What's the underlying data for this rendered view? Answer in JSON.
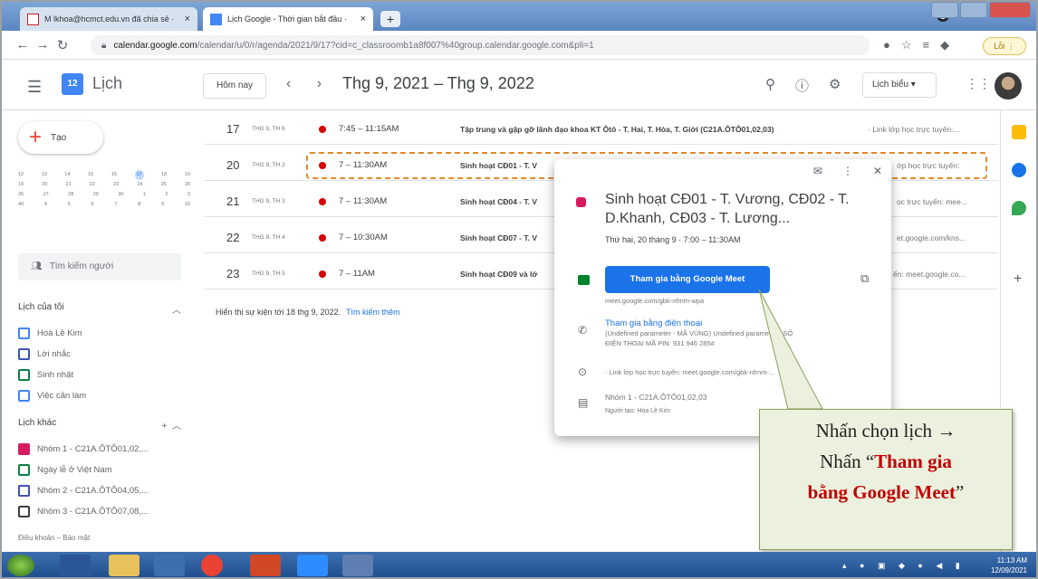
{
  "browser": {
    "tabs": [
      {
        "label": "M  lkhoa@hcmct.edu.vn đã chia sẻ ·",
        "close": "×"
      },
      {
        "label": "Lịch Google - Thời gian bắt đầu ·",
        "close": "×"
      }
    ],
    "newtab": "+",
    "url_domain": "calendar.google.com",
    "url_path": "/calendar/u/0/r/agenda/2021/9/17?cid=c_classroomb1a8f007%40group.calendar.google.com&pli=1",
    "profile_badge": "Lỗi ⋮"
  },
  "header": {
    "app_title": "Lịch",
    "logo_text": "12",
    "today_button": "Hôm nay",
    "nav_arrows": "‹ ›",
    "date_range": "Thg 9, 2021 – Thg 9, 2022",
    "view_select": "Lịch biểu ▾"
  },
  "sidebar": {
    "create_label": "Tạo",
    "minical_rows": [
      [
        "12",
        "13",
        "14",
        "15",
        "16",
        "17",
        "18",
        "19"
      ],
      [
        "19",
        "20",
        "21",
        "22",
        "23",
        "24",
        "25",
        "26"
      ],
      [
        "26",
        "27",
        "28",
        "29",
        "30",
        "1",
        "2",
        "3"
      ],
      [
        "40",
        "4",
        "5",
        "6",
        "7",
        "8",
        "9",
        "10"
      ]
    ],
    "search_people": "Tìm kiếm người",
    "my_cal_heading": "Lịch của tôi",
    "my_calendars": [
      "Hoà Lê Kim",
      "Lời nhắc",
      "Sinh nhật",
      "Việc cần làm"
    ],
    "other_heading": "Lịch khác",
    "other_calendars": [
      "Nhóm 1 - C21A.ÔTÔ01,02,...",
      "Ngày lễ ở Việt Nam",
      "Nhóm 2 - C21A.ÔTÔ04,05,...",
      "Nhóm 3 - C21A.ÔTÔ07,08,..."
    ],
    "footer": "Điều khoản – Bảo mật",
    "colors": [
      "#1a73e8",
      "#1a73e8",
      "#0b8043",
      "#1a73e8",
      "#d81b60",
      "#0b8043",
      "#1a73e8",
      "#3c4043"
    ]
  },
  "agenda": {
    "rows": [
      {
        "day": "17",
        "dow": "THG 9, TH 6",
        "time": "7:45 – 11:15AM",
        "title": "Tập trung và gặp gỡ lãnh đạo khoa KT Ôtô - T. Hai, T. Hòa, T. Giới (C21A.ÔTÔ01,02,03)",
        "desc": "· Link lớp học trực tuyến:..."
      },
      {
        "day": "20",
        "dow": "THG 9, TH 2",
        "time": "7 – 11:30AM",
        "title": "Sinh hoạt CĐ01 - T. V",
        "desc": "ớp học trực tuyến:"
      },
      {
        "day": "21",
        "dow": "THG 9, TH 3",
        "time": "7 – 11:30AM",
        "title": "Sinh hoạt CĐ04 - T. V",
        "desc": "ọc trực tuyến: mee..."
      },
      {
        "day": "22",
        "dow": "THG 9, TH 4",
        "time": "7 – 10:30AM",
        "title": "Sinh hoạt CĐ07 - T. V",
        "desc": "et.google.com/kns..."
      },
      {
        "day": "23",
        "dow": "THG 9, TH 5",
        "time": "7 – 11AM",
        "title": "Sinh hoạt CĐ09 và lớ",
        "desc": "ến: meet.google.co..."
      }
    ],
    "more_text": "Hiển thị sự kiện tới 18 thg 9, 2022.",
    "more_link": "Tìm kiếm thêm"
  },
  "popup": {
    "title": "Sinh hoạt CĐ01 - T. Vương, CĐ02 - T. D.Khanh, CĐ03 - T. Lương...",
    "date": "Thứ hai, 20 tháng 9 · 7:00 – 11:30AM",
    "meet_button": "Tham gia bằng Google Meet",
    "meet_url": "meet.google.com/gbk-nfmm-wpa",
    "phone_link": "Tham gia bằng điện thoại",
    "phone_detail": "(Undefined parameter - MÃ VÙNG) Undefined parameter - SỐ ĐIỆN THOẠI MÃ PIN: 931 946 285#",
    "location": "· Link lớp học trực tuyến: meet.google.com/gbk-nfmm-...",
    "calendar": "Nhóm 1 - C21A.ÔTÔ01,02,03",
    "creator": "Người tạo: Hòa Lê Kim"
  },
  "callout": {
    "line1": "Nhấn chọn lịch →",
    "line2_prefix": "Nhấn “",
    "line2_red": "Tham gia",
    "line3_red": "bằng Google Meet",
    "line3_suffix": "”"
  },
  "taskbar": {
    "time": "11:13 AM",
    "date": "12/09/2021"
  }
}
